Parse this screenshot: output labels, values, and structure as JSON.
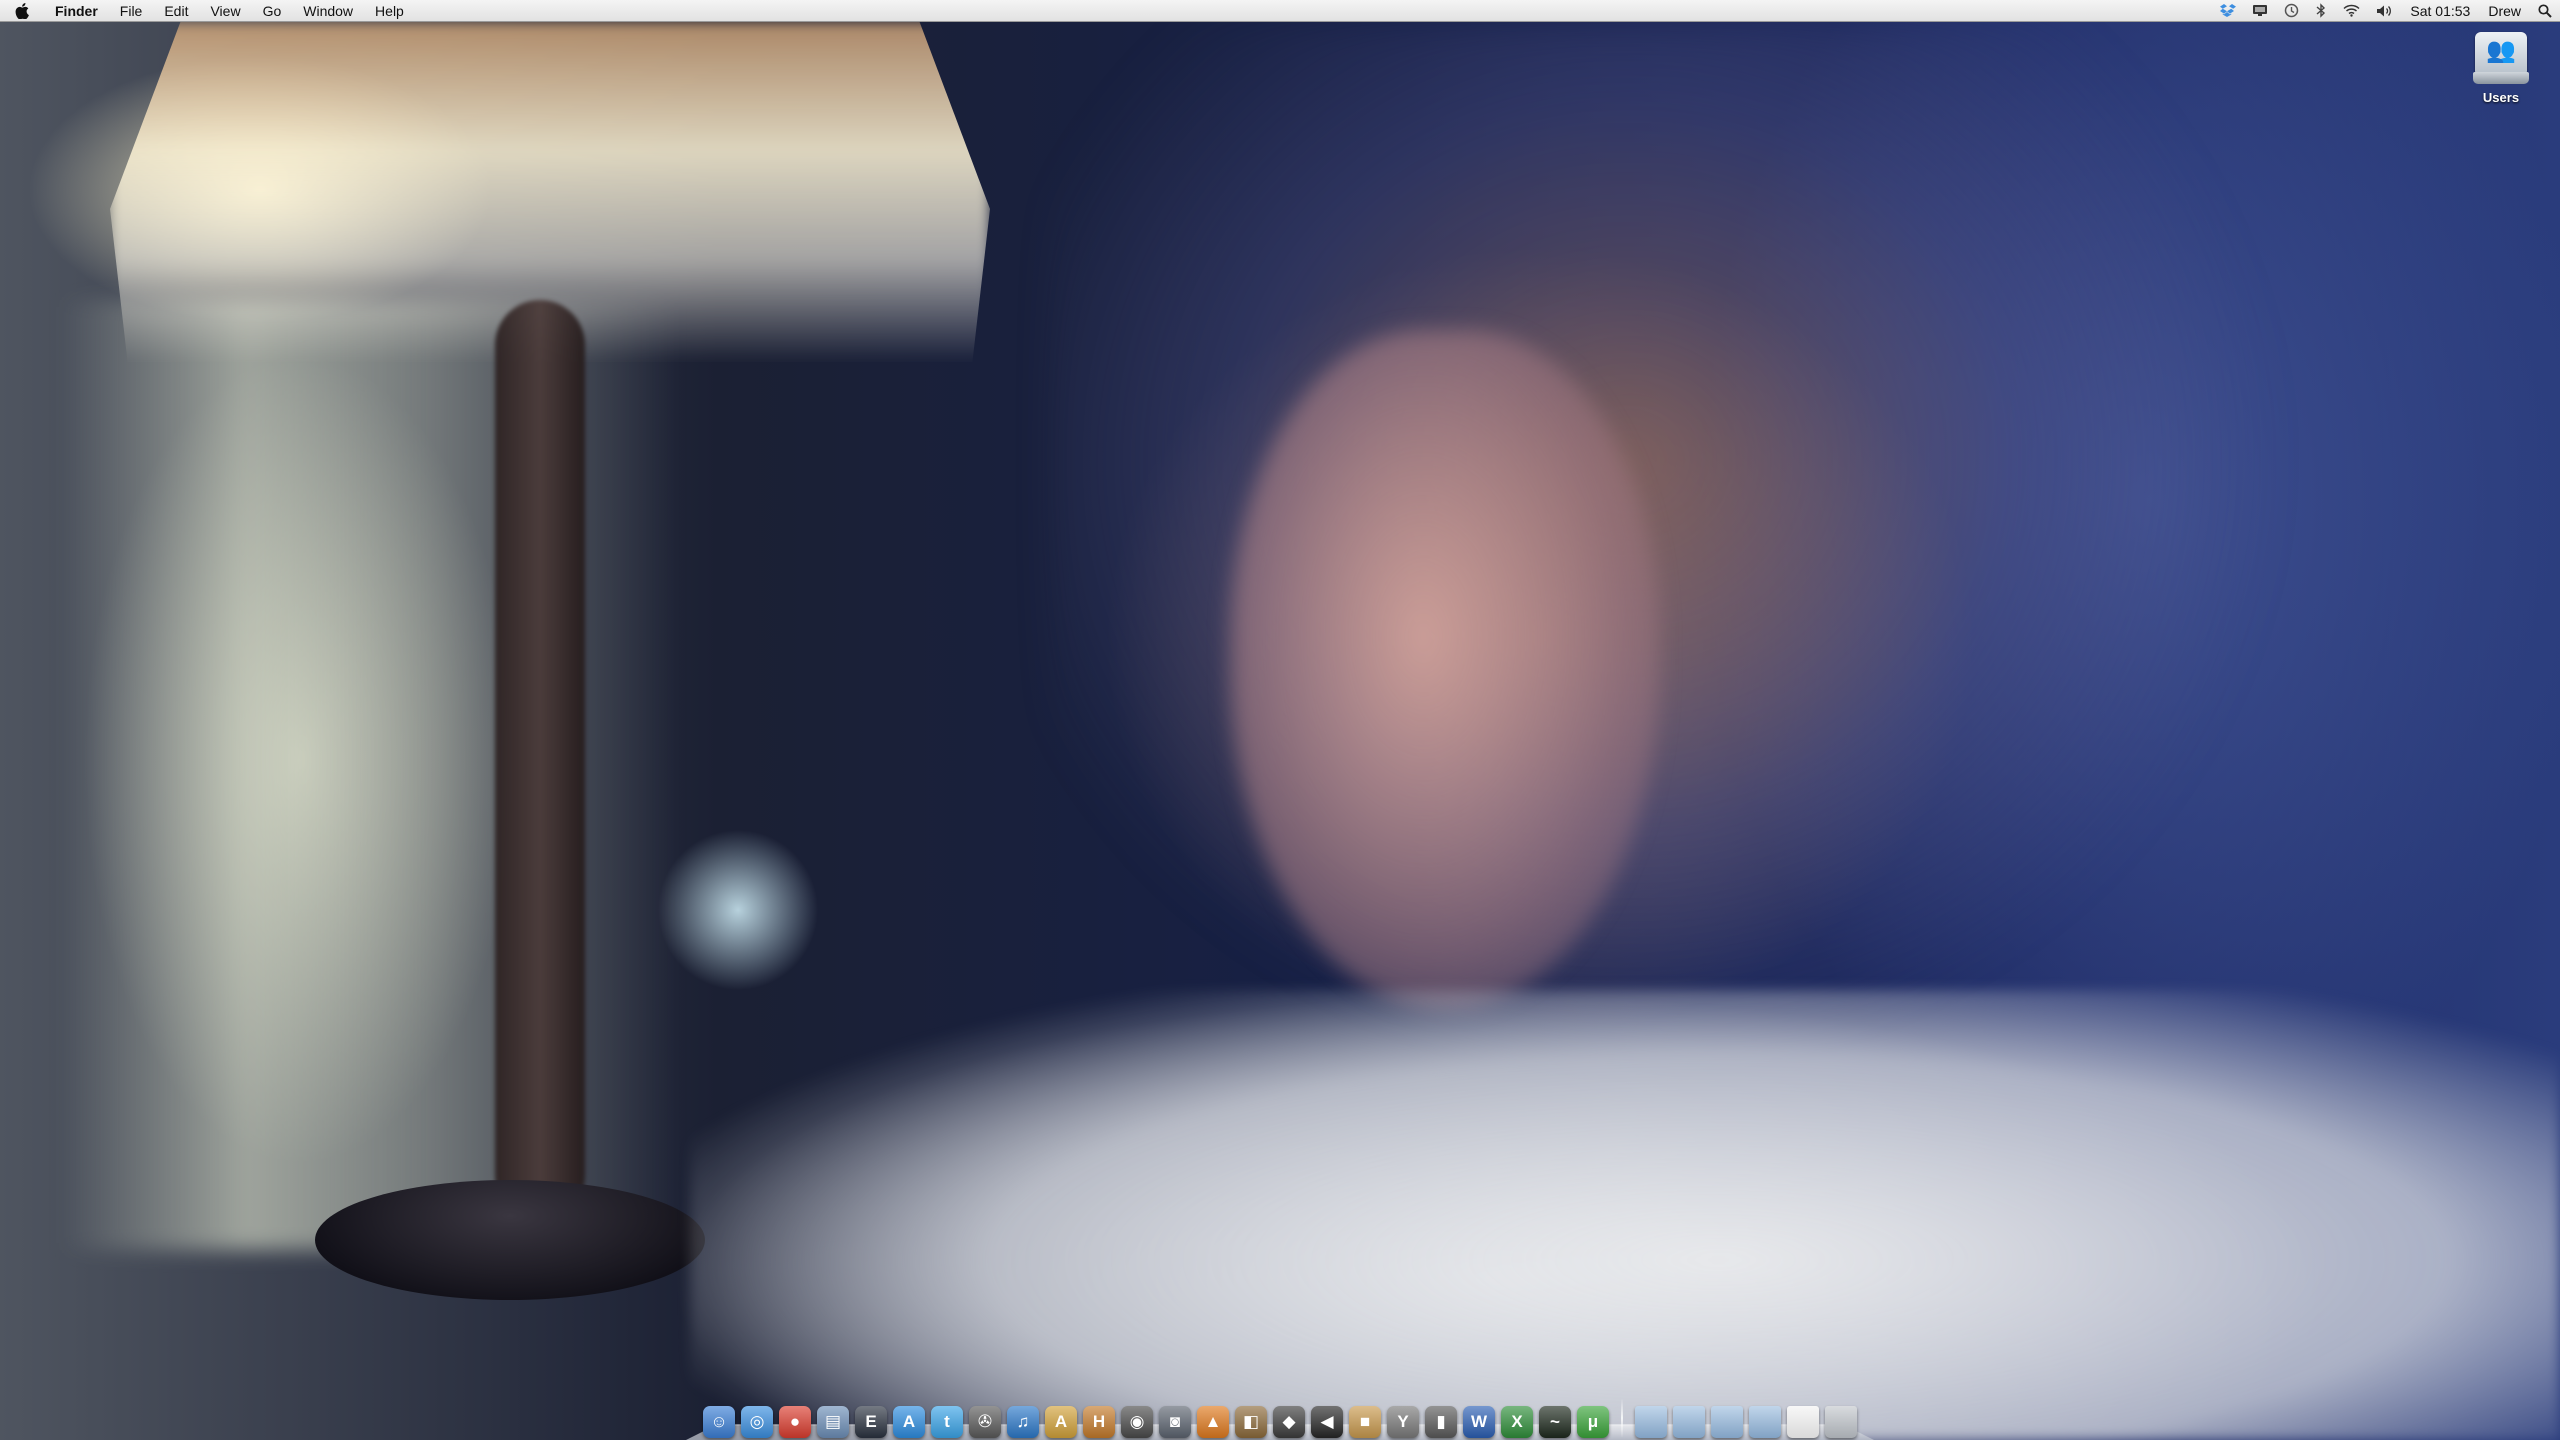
{
  "menubar": {
    "apple_icon": "apple-icon",
    "app_name": "Finder",
    "menus": [
      "File",
      "Edit",
      "View",
      "Go",
      "Window",
      "Help"
    ],
    "status_icons": [
      "dropbox-icon",
      "display-icon",
      "time-machine-icon",
      "bluetooth-icon",
      "wifi-icon",
      "volume-icon"
    ],
    "clock": "Sat 01:53",
    "user": "Drew",
    "spotlight_icon": "search-icon"
  },
  "desktop": {
    "icons": [
      {
        "label": "Users",
        "icon": "users-drive-icon"
      }
    ]
  },
  "dock": {
    "apps": [
      {
        "id": "finder",
        "glyph": "☺",
        "color": "#3b7fd6",
        "running": true
      },
      {
        "id": "safari",
        "glyph": "◎",
        "color": "#3a8fe0",
        "running": true
      },
      {
        "id": "chrome",
        "glyph": "●",
        "color": "#db3d2f",
        "running": true
      },
      {
        "id": "preview",
        "glyph": "▤",
        "color": "#6d8fb8",
        "running": false
      },
      {
        "id": "eve-online",
        "glyph": "E",
        "color": "#2a3240",
        "running": false
      },
      {
        "id": "app-store",
        "glyph": "A",
        "color": "#2d8de0",
        "running": false
      },
      {
        "id": "twitter",
        "glyph": "t",
        "color": "#3aa4e8",
        "running": false
      },
      {
        "id": "dvd-player",
        "glyph": "✇",
        "color": "#5a5a5a",
        "running": false
      },
      {
        "id": "itunes",
        "glyph": "♫",
        "color": "#2c79c9",
        "running": true
      },
      {
        "id": "aperture",
        "glyph": "A",
        "color": "#d2a23a",
        "running": false
      },
      {
        "id": "instruments",
        "glyph": "H",
        "color": "#c47a2a",
        "running": false
      },
      {
        "id": "chat",
        "glyph": "◉",
        "color": "#4a4a4a",
        "running": false
      },
      {
        "id": "facetime",
        "glyph": "◙",
        "color": "#5c6470",
        "running": false
      },
      {
        "id": "vlc",
        "glyph": "▲",
        "color": "#e07a1e",
        "running": false
      },
      {
        "id": "photo-viewer",
        "glyph": "◧",
        "color": "#8c6a3a",
        "running": false
      },
      {
        "id": "utility",
        "glyph": "◆",
        "color": "#3c3c3c",
        "running": false
      },
      {
        "id": "terminal-tool",
        "glyph": "◀",
        "color": "#262626",
        "running": false
      },
      {
        "id": "archive",
        "glyph": "■",
        "color": "#c99a4e",
        "running": false
      },
      {
        "id": "tuxedo",
        "glyph": "Y",
        "color": "#7a7a7a",
        "running": false
      },
      {
        "id": "script-editor",
        "glyph": "▮",
        "color": "#5a5a5a",
        "running": false
      },
      {
        "id": "word",
        "glyph": "W",
        "color": "#2b5fb4",
        "running": false
      },
      {
        "id": "excel",
        "glyph": "X",
        "color": "#2f8f3a",
        "running": false
      },
      {
        "id": "activity-monitor",
        "glyph": "~",
        "color": "#1e2a1e",
        "running": true
      },
      {
        "id": "utorrent",
        "glyph": "μ",
        "color": "#3aa53a",
        "running": true
      }
    ],
    "stacks": [
      {
        "id": "applications-folder",
        "color": "#8fb4da"
      },
      {
        "id": "documents-folder",
        "color": "#8fb4da"
      },
      {
        "id": "downloads-folder",
        "color": "#8fb4da"
      },
      {
        "id": "dropbox-folder",
        "color": "#8fb4da"
      },
      {
        "id": "mail-stack",
        "color": "#f2f2f2"
      },
      {
        "id": "trash",
        "color": "#b9bec4"
      }
    ]
  }
}
